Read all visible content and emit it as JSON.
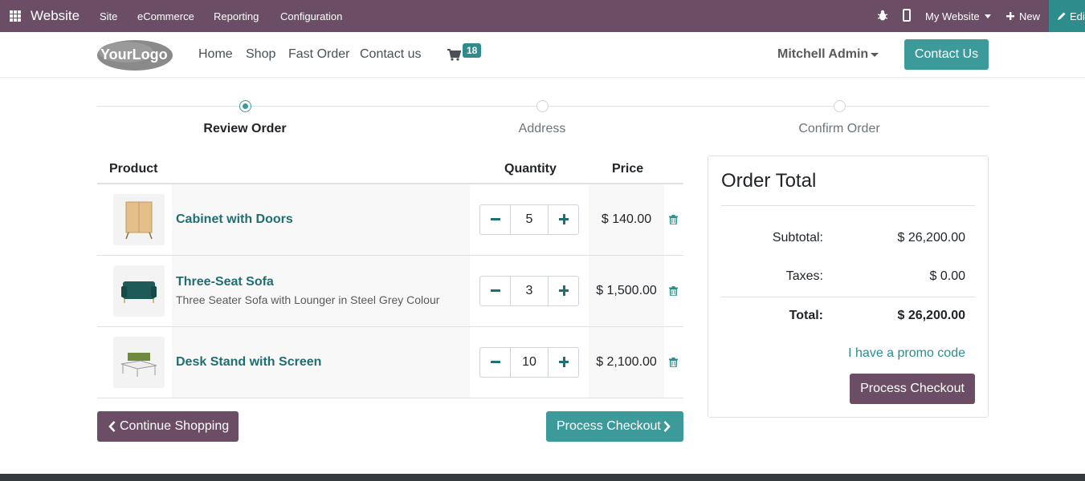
{
  "adminbar": {
    "app_name": "Website",
    "menus": [
      "Site",
      "eCommerce",
      "Reporting",
      "Configuration"
    ],
    "website_selector": "My Website",
    "new_label": "New",
    "edit_label": "Edit"
  },
  "header": {
    "logo_text": "YourLogo",
    "nav": [
      "Home",
      "Shop",
      "Fast Order",
      "Contact us"
    ],
    "cart_count": "18",
    "user_name": "Mitchell Admin",
    "contact_button": "Contact Us"
  },
  "wizard": {
    "steps": [
      {
        "label": "Review Order",
        "active": true
      },
      {
        "label": "Address",
        "active": false
      },
      {
        "label": "Confirm Order",
        "active": false
      }
    ]
  },
  "cart": {
    "columns": {
      "product": "Product",
      "quantity": "Quantity",
      "price": "Price"
    },
    "rows": [
      {
        "name": "Cabinet with Doors",
        "description": "",
        "quantity": "5",
        "price": "$ 140.00"
      },
      {
        "name": "Three-Seat Sofa",
        "description": "Three Seater Sofa with Lounger in Steel Grey Colour",
        "quantity": "3",
        "price": "$ 1,500.00"
      },
      {
        "name": "Desk Stand with Screen",
        "description": "",
        "quantity": "10",
        "price": "$ 2,100.00"
      }
    ],
    "continue_button": "Continue Shopping",
    "checkout_button": "Process Checkout"
  },
  "summary": {
    "title": "Order Total",
    "subtotal_label": "Subtotal:",
    "subtotal_value": "$ 26,200.00",
    "taxes_label": "Taxes:",
    "taxes_value": "$ 0.00",
    "total_label": "Total:",
    "total_value": "$ 26,200.00",
    "promo_link": "I have a promo code",
    "checkout_button": "Process Checkout"
  },
  "colors": {
    "admin_bar": "#6b4e66",
    "primary": "#3d9a9b",
    "secondary": "#6b4e66",
    "link": "#1f6e72"
  }
}
